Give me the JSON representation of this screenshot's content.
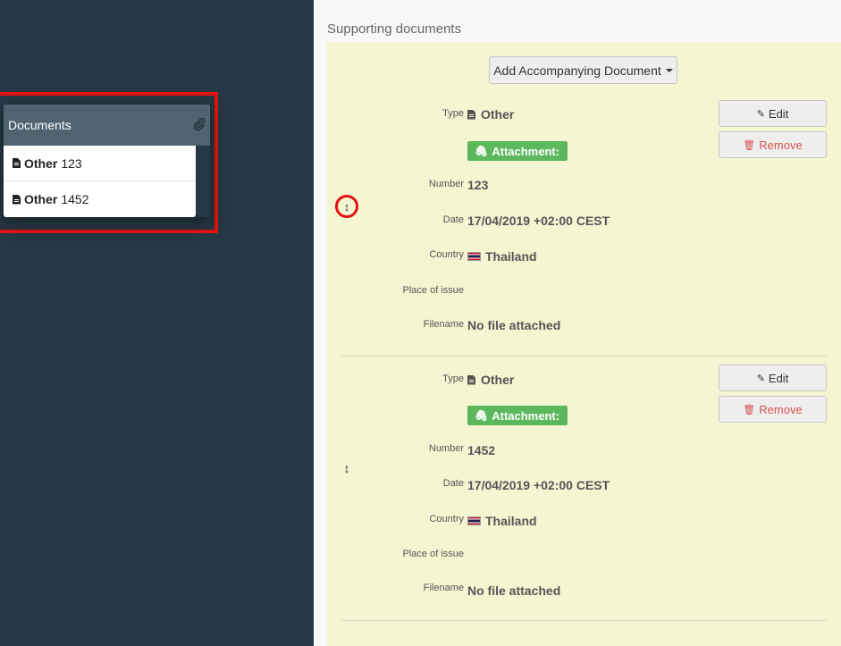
{
  "sidebar_panel": {
    "header_label": "Documents",
    "header_icon": "paperclip-icon",
    "items": [
      {
        "type": "Other",
        "number": "123"
      },
      {
        "type": "Other",
        "number": "1452"
      }
    ]
  },
  "main": {
    "section_title": "Supporting documents",
    "add_button_label": "Add Accompanying Document",
    "field_labels": {
      "type": "Type",
      "number": "Number",
      "date": "Date",
      "country": "Country",
      "place_of_issue": "Place of issue",
      "filename": "Filename"
    },
    "attachment_label": "Attachment:",
    "edit_label": "Edit",
    "remove_label": "Remove",
    "documents": [
      {
        "type": "Other",
        "number": "123",
        "date": "17/04/2019 +02:00 CEST",
        "country": "Thailand",
        "place_of_issue": "",
        "filename": "No file attached"
      },
      {
        "type": "Other",
        "number": "1452",
        "date": "17/04/2019 +02:00 CEST",
        "country": "Thailand",
        "place_of_issue": "",
        "filename": "No file attached"
      }
    ]
  },
  "colors": {
    "sidebar_bg": "#263845",
    "panel_header_bg": "#4f6470",
    "yellow_panel_bg": "#f5f5d2",
    "attachment_green": "#5cb85c",
    "remove_red": "#d9534f",
    "highlight_red": "#e41313"
  }
}
